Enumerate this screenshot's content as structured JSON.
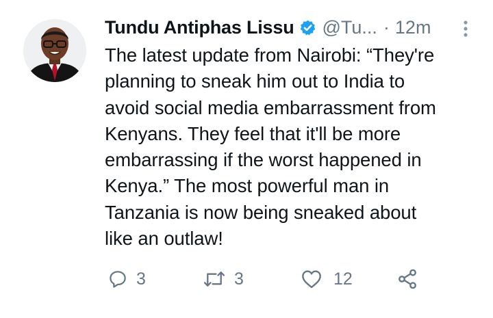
{
  "tweet": {
    "author": {
      "display_name": "Tundu Antiphas Lissu",
      "handle": "@Tu...",
      "verified": true,
      "avatar_icon": "profile-photo"
    },
    "separator": "·",
    "time": "12m",
    "body_lines": [
      "The latest update from Nairobi: “They're",
      "planning to sneak him out to India to",
      "avoid social media embarrassment from",
      "Kenyans. They feel that it'll be more",
      "embarrassing if the worst happened in",
      "Kenya.” The most powerful man in",
      "Tanzania is now being sneaked about",
      "like an outlaw!"
    ],
    "actions": {
      "reply": {
        "icon": "reply-icon",
        "count": "3"
      },
      "retweet": {
        "icon": "retweet-icon",
        "count": "3"
      },
      "like": {
        "icon": "heart-icon",
        "count": "12"
      },
      "share": {
        "icon": "share-icon"
      }
    }
  },
  "colors": {
    "text_primary": "#0f1419",
    "text_secondary": "#657786",
    "verified_blue": "#1da1f2",
    "icon_gray": "#657786"
  }
}
